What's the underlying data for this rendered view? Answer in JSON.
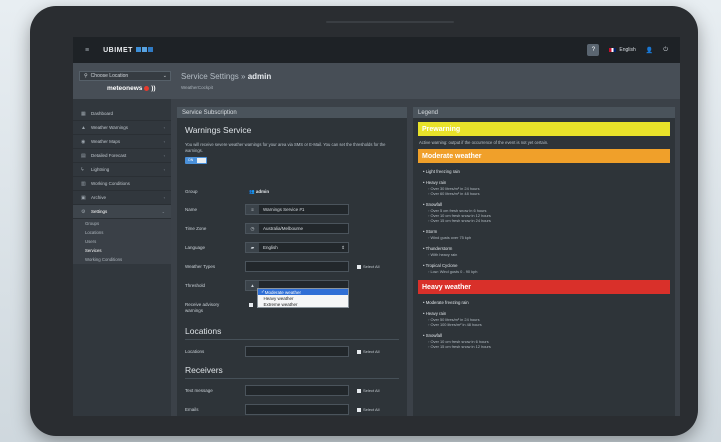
{
  "topbar": {
    "brand": "UBIMET",
    "help": "?",
    "language": "English"
  },
  "location": {
    "select_label": "Choose Location",
    "partner_logo": "meteonews"
  },
  "page": {
    "title_prefix": "Service Settings » ",
    "title_user": "admin",
    "subtitle": "WeatherCockpit"
  },
  "sidebar": {
    "items": [
      {
        "label": "Dashboard",
        "icon": "grid-icon"
      },
      {
        "label": "Weather Warnings",
        "icon": "warning-icon"
      },
      {
        "label": "Weather Maps",
        "icon": "globe-icon"
      },
      {
        "label": "Detailed Forecast",
        "icon": "chart-icon"
      },
      {
        "label": "Lightning",
        "icon": "lightning-icon"
      },
      {
        "label": "Working Conditions",
        "icon": "tasks-icon"
      },
      {
        "label": "Archive",
        "icon": "archive-icon"
      },
      {
        "label": "Settings",
        "icon": "gear-icon"
      }
    ],
    "subitems": [
      "Groups",
      "Locations",
      "Users",
      "Services",
      "Working Conditions"
    ]
  },
  "subscription": {
    "header": "Service Subscription",
    "title": "Warnings Service",
    "description": "You will receive severe weather warnings for your area via SMS or E-Mail. You can set the thresholds for the warnings.",
    "toggle": "ON",
    "group_label": "Group",
    "group_value": "admin",
    "name_label": "Name",
    "name_value": "Warnings Service #1",
    "timezone_label": "Time Zone",
    "timezone_value": "Australia/Melbourne",
    "language_label": "Language",
    "language_value": "English",
    "weather_types_label": "Weather Types",
    "select_all": "Select All",
    "threshold_label": "Threshold",
    "threshold_options": [
      "Moderate weather",
      "Heavy weather",
      "Extreme weather"
    ],
    "advisory_label": "Receive advisory warnings",
    "locations_title": "Locations",
    "locations_label": "Locations",
    "receivers_title": "Receivers",
    "text_message_label": "Text message",
    "emails_label": "Emails"
  },
  "legend": {
    "header": "Legend",
    "prewarning": "Prewarning",
    "prewarning_note": "Active warning: output if the occurrence of the event is not yet certain.",
    "moderate": "Moderate weather",
    "moderate_items": [
      {
        "title": "Light freezing rain",
        "subs": []
      },
      {
        "title": "Heavy rain",
        "subs": [
          "Over 30 litres/m² in 24 hours",
          "Over 60 litres/m² in 48 hours"
        ]
      },
      {
        "title": "Snowfall",
        "subs": [
          "Over 5 cm fresh snow in 6 hours",
          "Over 10 cm fresh snow in 12 hours",
          "Over 15 cm fresh snow in 24 hours"
        ]
      },
      {
        "title": "Storm",
        "subs": [
          "Wind gusts over 75 kph"
        ]
      },
      {
        "title": "Thunderstorm",
        "subs": [
          "With heavy rain"
        ]
      },
      {
        "title": "Tropical Cyclone",
        "subs": [
          "Low: Wind gusts 0 - 90 kph"
        ]
      }
    ],
    "heavy": "Heavy weather",
    "heavy_items": [
      {
        "title": "Moderate freezing rain",
        "subs": []
      },
      {
        "title": "Heavy rain",
        "subs": [
          "Over 50 litres/m² in 24 hours",
          "Over 100 litres/m² in 48 hours"
        ]
      },
      {
        "title": "Snowfall",
        "subs": [
          "Over 10 cm fresh snow in 6 hours",
          "Over 15 cm fresh snow in 12 hours"
        ]
      }
    ],
    "colors": {
      "prewarning": "#e8e22a",
      "moderate": "#f0a02a",
      "heavy": "#d9302a"
    }
  }
}
